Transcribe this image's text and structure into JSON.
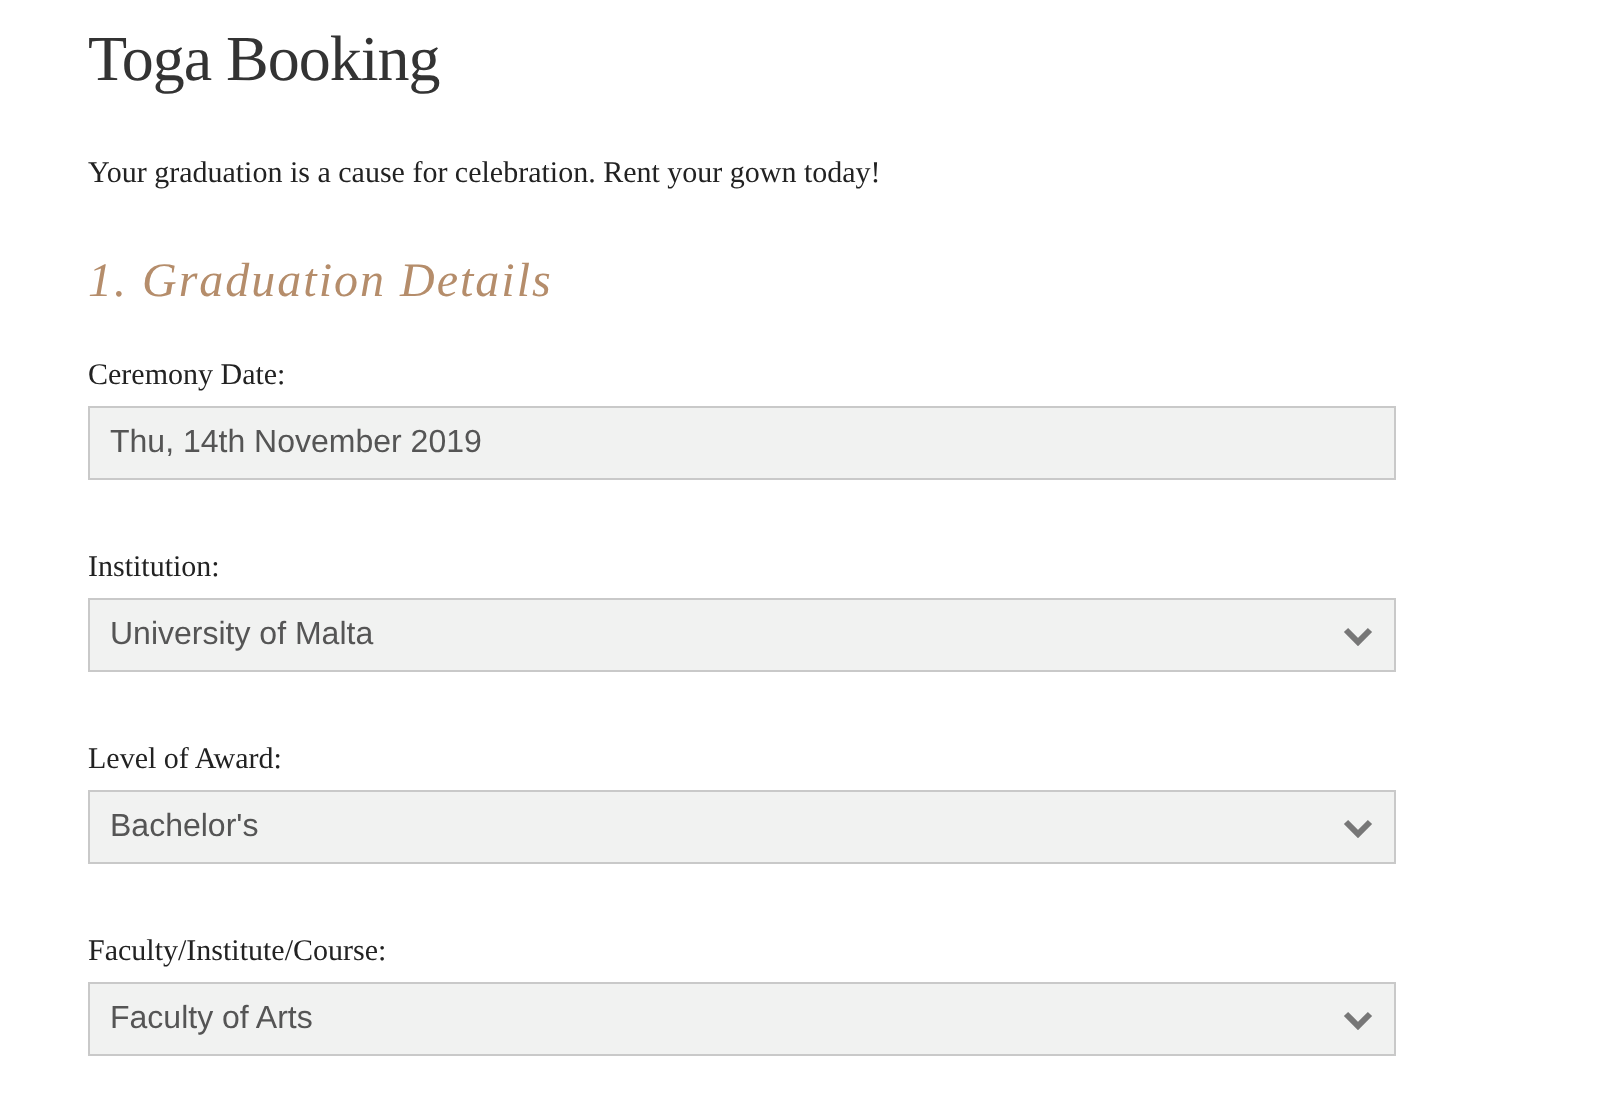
{
  "title": "Toga Booking",
  "intro": "Your graduation is a cause for celebration. Rent your gown today!",
  "section": {
    "heading": "1. Graduation Details"
  },
  "fields": [
    {
      "kind": "text",
      "label": "Ceremony Date:",
      "value": "Thu, 14th November 2019"
    },
    {
      "kind": "select",
      "label": "Institution:",
      "value": "University of Malta"
    },
    {
      "kind": "select",
      "label": "Level of Award:",
      "value": "Bachelor's"
    },
    {
      "kind": "select",
      "label": "Faculty/Institute/Course:",
      "value": "Faculty of Arts"
    }
  ]
}
